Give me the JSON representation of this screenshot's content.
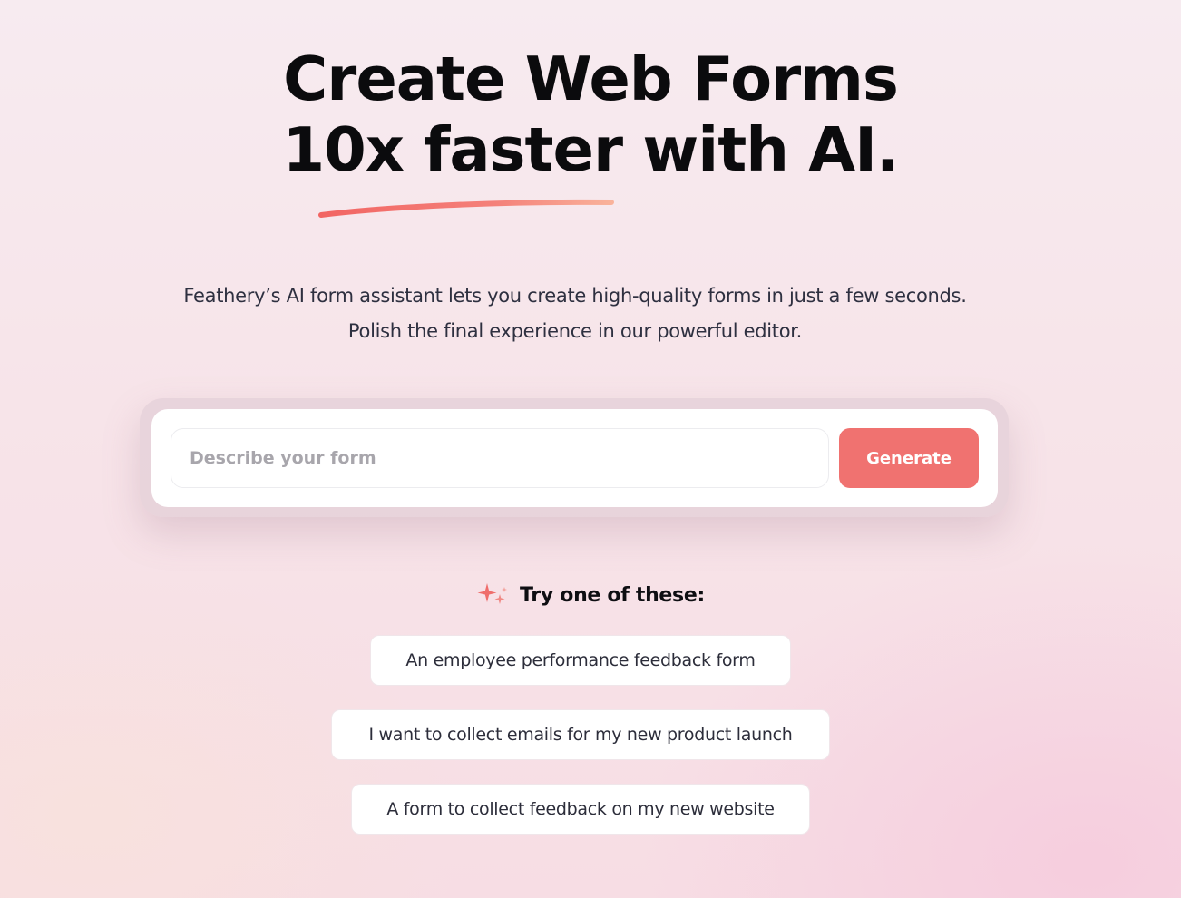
{
  "hero": {
    "title_line1": "Create Web Forms",
    "title_line2": "10x faster with AI.",
    "subtitle": "Feathery’s AI form assistant lets you create high-quality forms in just a few seconds. Polish the final experience in our powerful editor."
  },
  "prompt": {
    "placeholder": "Describe your form",
    "value": "",
    "button_label": "Generate"
  },
  "suggestions": {
    "heading": "Try one of these:",
    "icon": "sparkle-icon",
    "items": [
      "An employee performance feedback form",
      "I want to collect emails for my new product launch",
      "A form to collect feedback on my new website"
    ]
  },
  "colors": {
    "accent": "#f07270",
    "underline_start": "#f26563",
    "underline_end": "#f9b29a",
    "title_text": "#0b0b0d",
    "body_text": "#2e3040"
  }
}
